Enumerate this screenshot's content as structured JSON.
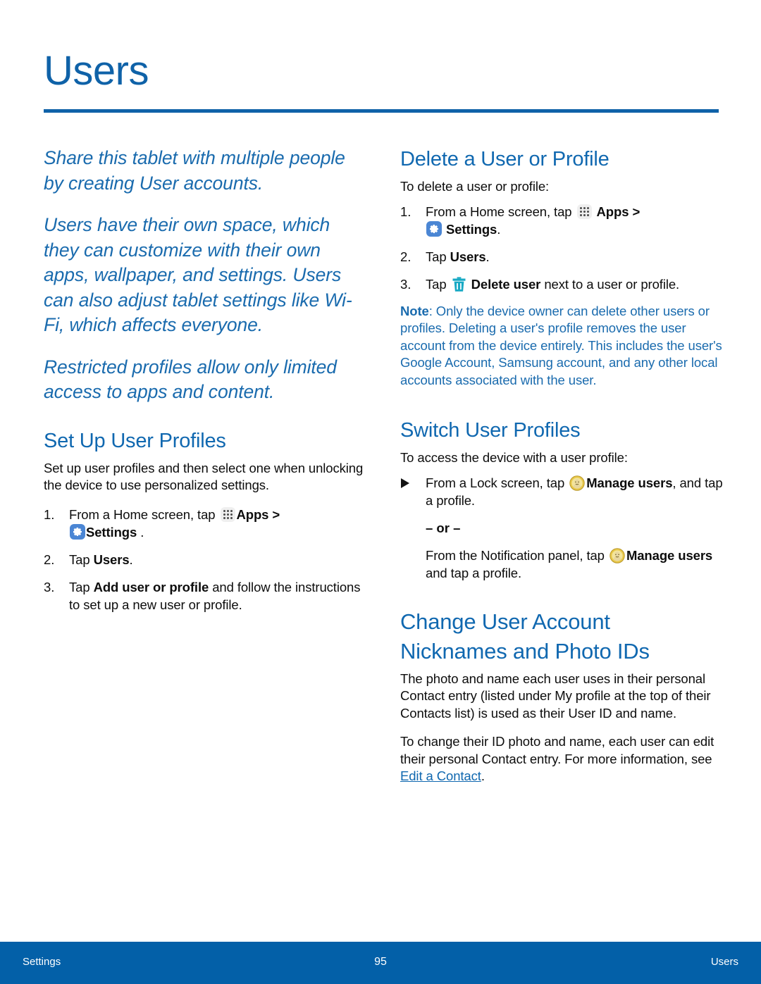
{
  "document": {
    "title": "Users"
  },
  "colors": {
    "heading_blue": "#1068b0",
    "intro_blue": "#1a6bae",
    "rule_blue": "#0f62a8",
    "footer_blue": "#0360a8",
    "settings_icon_blue": "#4b86d4",
    "trash_icon_cyan": "#17a9c4",
    "user_icon_gold": "#e8c84a"
  },
  "left_column": {
    "intro_paragraphs": [
      "Share this tablet with multiple people by creating User accounts.",
      "Users have their own space, which they can customize with their own apps, wallpaper, and settings. Users can also adjust tablet settings like Wi-Fi, which affects everyone.",
      "Restricted profiles allow only limited access to apps and content."
    ],
    "set_up_section": {
      "heading": "Set Up User Profiles",
      "intro": "Set up user profiles and then select one when unlocking the device to use personalized settings.",
      "steps": [
        {
          "number": "1.",
          "pre": "From a Home screen, tap",
          "apps_label": "Apps",
          "separator": ">",
          "settings_label": "Settings",
          "post": "."
        },
        {
          "number": "2.",
          "pre": "Tap",
          "bold": "Users",
          "post": "."
        },
        {
          "number": "3.",
          "pre": "Tap",
          "bold": "Add user or profile",
          "post": " and follow the instructions to set up a new user or profile."
        }
      ]
    }
  },
  "right_column": {
    "delete_section": {
      "heading": "Delete a User or Profile",
      "intro": "To delete a user or profile:",
      "steps": [
        {
          "number": "1.",
          "pre": "From a Home screen, tap",
          "apps_label": "Apps",
          "separator": ">",
          "settings_label": "Settings",
          "post": "."
        },
        {
          "number": "2.",
          "pre": "Tap",
          "bold": "Users",
          "post": "."
        },
        {
          "number": "3.",
          "pre": "Tap",
          "bold": "Delete user",
          "post": " next to a user or profile."
        }
      ],
      "note_label": "Note",
      "note_text": ": Only the device owner can delete other users or profiles. Deleting a user's profile removes the user account from the device entirely. This includes the user's Google Account, Samsung account, and any other local accounts associated with the user."
    },
    "switch_section": {
      "heading": "Switch User Profiles",
      "intro": "To access the device with a user profile:",
      "step_pre": "From a Lock screen, tap",
      "step_bold": "Manage users",
      "step_post": ", and tap a profile.",
      "or_label": "– or –",
      "alt_pre": "From the Notification panel, tap",
      "alt_bold": "Manage users",
      "alt_post": " and tap a profile."
    },
    "nickname_section": {
      "heading_line1": "Change User Account",
      "heading_line2": "Nicknames and Photo IDs",
      "paragraph1": "The photo and name each user uses in their personal Contact entry (listed under My profile at the top of their Contacts list) is used as their User ID and name.",
      "paragraph2_pre": "To change their ID photo and name, each user can edit their personal Contact entry. For more information, see ",
      "paragraph2_link": "Edit a Contact",
      "paragraph2_post": "."
    }
  },
  "footer": {
    "left": "Settings",
    "page_number": "95",
    "right": "Users"
  }
}
